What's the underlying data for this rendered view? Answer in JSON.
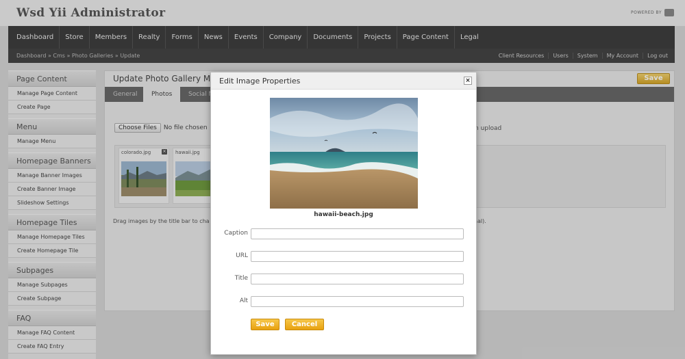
{
  "app": {
    "title": "Wsd Yii Administrator",
    "powered_by": "POWERED BY"
  },
  "nav": {
    "items": [
      "Dashboard",
      "Store",
      "Members",
      "Realty",
      "Forms",
      "News",
      "Events",
      "Company",
      "Documents",
      "Projects",
      "Page Content",
      "Legal"
    ]
  },
  "breadcrumb": {
    "text": "Dashboard » Cms » Photo Galleries » Update"
  },
  "utility_links": [
    "Client Resources",
    "Users",
    "System",
    "My Account",
    "Log out"
  ],
  "sidebar": {
    "sections": [
      {
        "title": "Page Content",
        "links": [
          "Manage Page Content",
          "Create Page"
        ]
      },
      {
        "title": "Menu",
        "links": [
          "Manage Menu"
        ]
      },
      {
        "title": "Homepage Banners",
        "links": [
          "Manage Banner Images",
          "Create Banner Image",
          "Slideshow Settings"
        ]
      },
      {
        "title": "Homepage Tiles",
        "links": [
          "Manage Homepage Tiles",
          "Create Homepage Tile"
        ]
      },
      {
        "title": "Subpages",
        "links": [
          "Manage Subpages",
          "Create Subpage"
        ]
      },
      {
        "title": "FAQ",
        "links": [
          "Manage FAQ Content",
          "Create FAQ Entry"
        ]
      }
    ]
  },
  "content": {
    "title": "Update Photo Gallery My",
    "save_label": "Save",
    "tabs": [
      "General",
      "Photos",
      "Social M"
    ],
    "file_button": "Choose Files",
    "file_status": "No file chosen",
    "upload_note": "h upload",
    "thumbnails": [
      {
        "name": "colorado.jpg"
      },
      {
        "name": "hawaii.jpg"
      }
    ],
    "drag_note": "Drag images by the title bar to cha",
    "drag_note_tail": "onal)."
  },
  "modal": {
    "title": "Edit Image Properties",
    "close_symbol": "×",
    "filename": "hawaii-beach.jpg",
    "fields": [
      {
        "label": "Caption",
        "value": ""
      },
      {
        "label": "URL",
        "value": ""
      },
      {
        "label": "Title",
        "value": ""
      },
      {
        "label": "Alt",
        "value": ""
      }
    ],
    "save_label": "Save",
    "cancel_label": "Cancel"
  },
  "colors": {
    "accent": "#e8a10f",
    "nav_bg": "#3e3e3e"
  }
}
